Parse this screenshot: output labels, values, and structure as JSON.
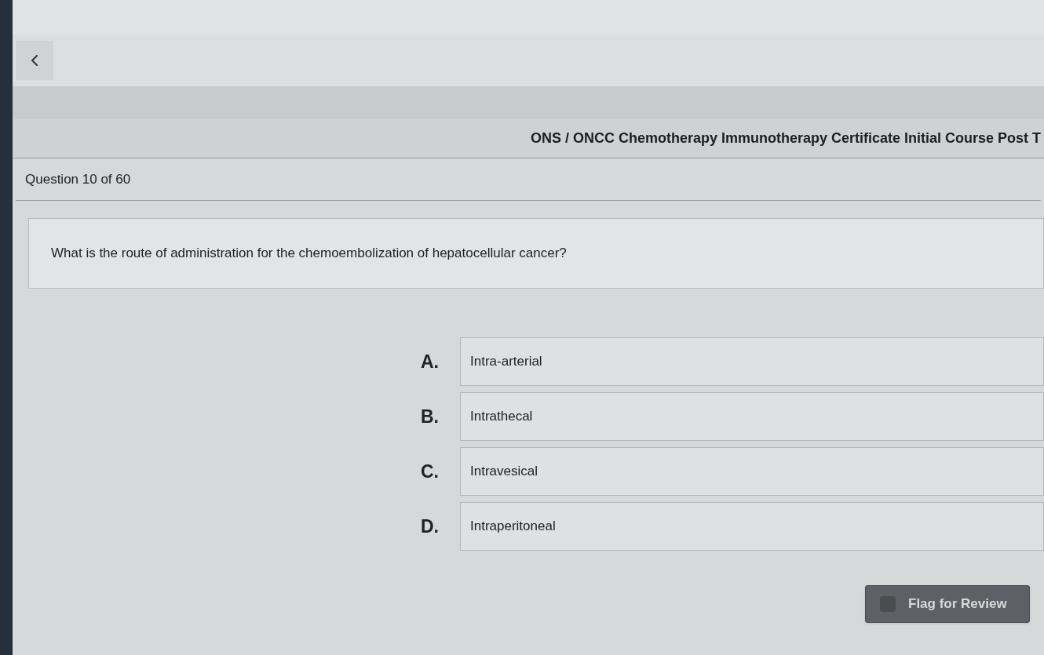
{
  "header": {
    "title": "ONS / ONCC Chemotherapy Immunotherapy Certificate Initial Course Post T"
  },
  "progress": {
    "label": "Question 10 of 60"
  },
  "question": {
    "text": "What is the route of administration for the chemoembolization of hepatocellular cancer?"
  },
  "options": [
    {
      "letter": "A.",
      "text": "Intra-arterial",
      "selected": false
    },
    {
      "letter": "B.",
      "text": "Intrathecal",
      "selected": false
    },
    {
      "letter": "C.",
      "text": "Intravesical",
      "selected": false
    },
    {
      "letter": "D.",
      "text": "Intraperitoneal",
      "selected": false
    }
  ],
  "flag_button": {
    "label": "Flag for Review",
    "checked": false
  }
}
